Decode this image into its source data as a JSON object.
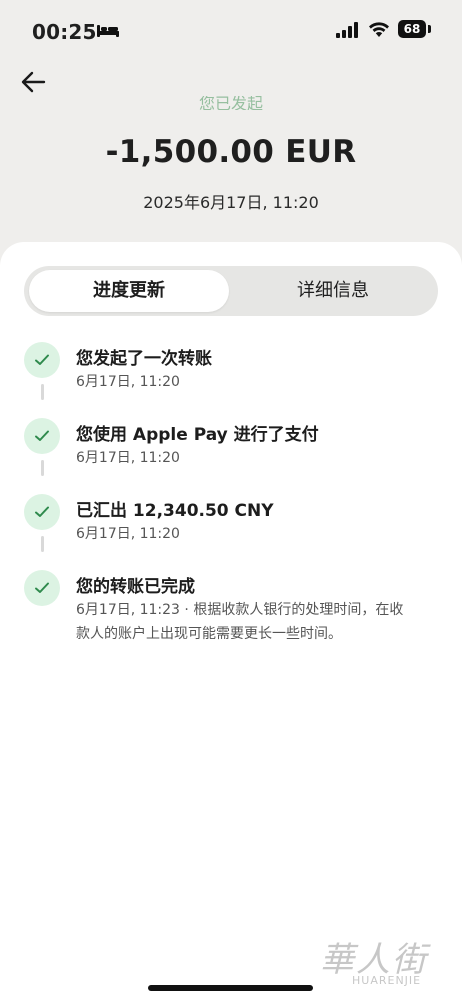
{
  "status_bar": {
    "time": "00:25",
    "battery": "68"
  },
  "header": {
    "status_text": "您已发起",
    "amount": "-1,500.00 EUR",
    "datetime": "2025年6月17日, 11:20"
  },
  "tabs": [
    {
      "label": "进度更新",
      "active": true
    },
    {
      "label": "详细信息",
      "active": false
    }
  ],
  "timeline": [
    {
      "title": "您发起了一次转账",
      "subtitle": "6月17日, 11:20"
    },
    {
      "title": "您使用 Apple Pay 进行了支付",
      "subtitle": "6月17日, 11:20"
    },
    {
      "title": "已汇出 12,340.50 CNY",
      "subtitle": "6月17日, 11:20"
    },
    {
      "title": "您的转账已完成",
      "subtitle": "6月17日, 11:23 · 根据收款人银行的处理时间，在收款人的账户上出现可能需要更长一些时间。"
    }
  ],
  "watermark": {
    "cn": "華人街",
    "en": "HUARENJIE"
  },
  "colors": {
    "accent": "#4e9a62",
    "check_bg": "#dcf3e3",
    "background": "#efeeec"
  }
}
